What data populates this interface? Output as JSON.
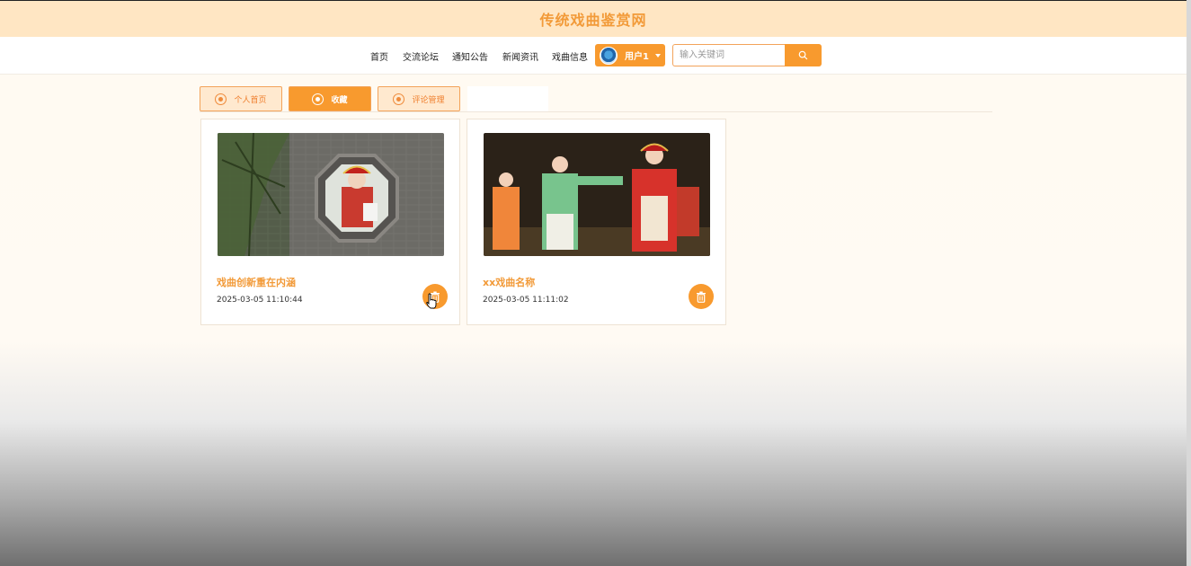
{
  "header": {
    "site_title": "传统戏曲鉴赏网"
  },
  "nav": {
    "items": [
      {
        "label": "首页"
      },
      {
        "label": "交流论坛"
      },
      {
        "label": "通知公告"
      },
      {
        "label": "新闻资讯"
      },
      {
        "label": "戏曲信息"
      }
    ],
    "user": {
      "name": "用户1"
    },
    "search": {
      "placeholder": "输入关键词",
      "value": ""
    }
  },
  "tabs": [
    {
      "label": "个人首页",
      "active": false
    },
    {
      "label": "收藏",
      "active": true
    },
    {
      "label": "评论管理",
      "active": false
    }
  ],
  "favorites": [
    {
      "title": "戏曲创新重在内涵",
      "date": "2025-03-05 11:10:44"
    },
    {
      "title": "xx戏曲名称",
      "date": "2025-03-05 11:11:02"
    }
  ],
  "colors": {
    "accent": "#f89a2e",
    "header_bg": "#ffe6c3",
    "title": "#f29a38"
  },
  "icons": {
    "search": "search-icon",
    "delete": "trash-icon",
    "tab": "circle-icon",
    "avatar": "avatar-image"
  }
}
